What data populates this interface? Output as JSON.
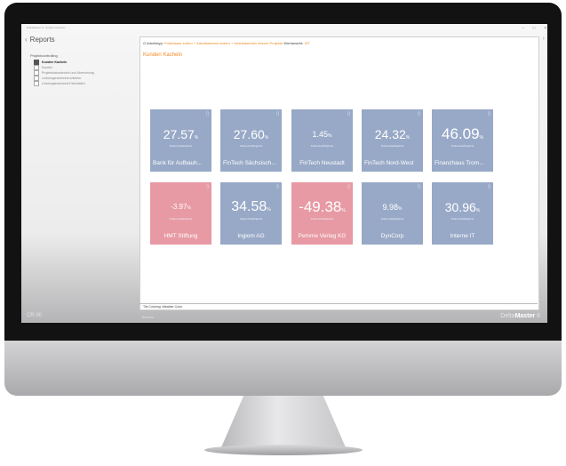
{
  "window": {
    "title": "DeltaMaster 6 - Kunden Kacheln"
  },
  "sidebar": {
    "title": "Reports",
    "group": "Projektcontrolling",
    "items": [
      {
        "label": "Kunden Kacheln",
        "active": true
      },
      {
        "label": "Kunden",
        "active": false
      },
      {
        "label": "Projektstatusbericht und Abrechnung",
        "active": false
      },
      {
        "label": "Leistungsnachweis Anbieter",
        "active": false
      },
      {
        "label": "Leistungsnachweis Fahrtdaten",
        "active": false
      }
    ]
  },
  "breadcrumb": {
    "prefix": "G",
    "label": "Arbeitstyp:",
    "path": "Fahrtdauer extern + Arbeitsbereich extern + Arbeitsbereich Interne Projekte",
    "view_label": "Wertansicht:",
    "view_value": "IST"
  },
  "page_title": "Kunden Kacheln",
  "tiles": [
    {
      "value": "27.57",
      "unit": "%",
      "caption": "Finales Anteil/Ergebnis",
      "name": "Bank für Aufbauh...",
      "negative": false
    },
    {
      "value": "27.60",
      "unit": "%",
      "caption": "Finales Anteil/Ergebnis",
      "name": "FinTech Sächsisch...",
      "negative": false
    },
    {
      "value": "1.45",
      "unit": "%",
      "caption": "Finales Anteil/Ergebnis",
      "name": "FinTech Neustadt",
      "negative": false
    },
    {
      "value": "24.32",
      "unit": "%",
      "caption": "Finales Anteil/Ergebnis",
      "name": "FinTech Nord-West",
      "negative": false
    },
    {
      "value": "46.09",
      "unit": "%",
      "caption": "Finales Anteil/Ergebnis",
      "name": "Finanzhaus Trom...",
      "negative": false
    },
    {
      "value": "-3.97",
      "unit": "%",
      "caption": "Finales Anteil/Ergebnis",
      "name": "HMT Stiftung",
      "negative": true
    },
    {
      "value": "34.58",
      "unit": "%",
      "caption": "Finales Anteil/Ergebnis",
      "name": "Ingiom AG",
      "negative": false
    },
    {
      "value": "-49.38",
      "unit": "%",
      "caption": "Finales Anteil/Ergebnis",
      "name": "Pemme Verlag KG",
      "negative": true
    },
    {
      "value": "9.98",
      "unit": "%",
      "caption": "Finales Anteil/Ergebnis",
      "name": "DynCorp",
      "negative": false
    },
    {
      "value": "30.96",
      "unit": "%",
      "caption": "Finales Anteil/Ergebnis",
      "name": "Interne IT",
      "negative": false
    }
  ],
  "footer": {
    "tile_coloring": "Tile Coloring: Weather Color"
  },
  "bottom": {
    "left": "CR 00",
    "mode": "Browse",
    "brand_prefix": "Delta",
    "brand_bold": "Master",
    "brand_suffix": "6"
  },
  "colors": {
    "tile_positive": "#98a9c7",
    "tile_negative": "#e79aa4",
    "accent": "#f08a24"
  },
  "icons": [
    "chevron-left-icon",
    "chevron-right-icon",
    "tile-info-icon"
  ]
}
